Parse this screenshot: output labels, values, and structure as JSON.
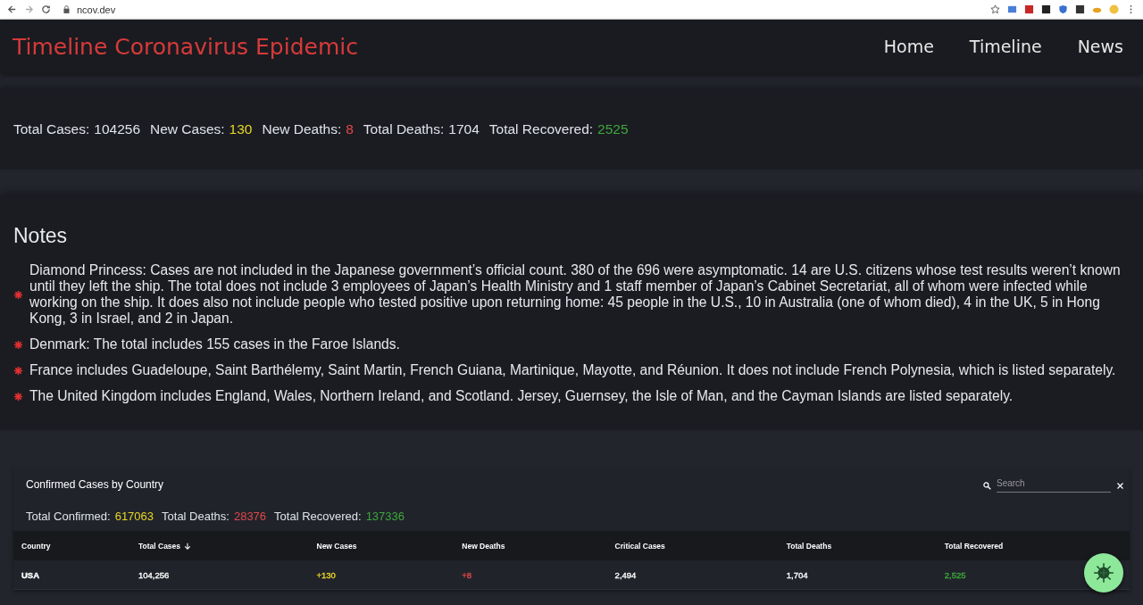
{
  "browser": {
    "url": "ncov.dev"
  },
  "header": {
    "title": "Timeline Coronavirus Epidemic",
    "nav": [
      {
        "label": "Home"
      },
      {
        "label": "Timeline"
      },
      {
        "label": "News"
      }
    ]
  },
  "summary": [
    {
      "label": "Total Cases:",
      "value": "104256",
      "color": "#dfe3ea"
    },
    {
      "label": "New Cases:",
      "value": "130",
      "color": "#e8d626"
    },
    {
      "label": "New Deaths:",
      "value": "8",
      "color": "#e04848"
    },
    {
      "label": "Total Deaths:",
      "value": "1704",
      "color": "#dfe3ea"
    },
    {
      "label": "Total Recovered:",
      "value": "2525",
      "color": "#3ca83c"
    }
  ],
  "notes": {
    "title": "Notes",
    "items": [
      "Diamond Princess: Cases are not included in the Japanese government’s official count. 380 of the 696 were asymptomatic. 14 are U.S. citizens whose test results weren’t known until they left the ship. The total does not include 3 employees of Japan’s Health Ministry and 1 staff member of Japan’s Cabinet Secretariat, all of whom were infected while working on the ship. It does also not include people who tested positive upon returning home: 45 people in the U.S., 10 in Australia (one of whom died), 4 in the UK, 5 in Hong Kong, 3 in Israel, and 2 in Japan.",
      "Denmark: The total includes 155 cases in the Faroe Islands.",
      "France includes Guadeloupe, Saint Barthélemy, Saint Martin, French Guiana, Martinique, Mayotte, and Réunion. It does not include French Polynesia, which is listed separately.",
      "The United Kingdom includes England, Wales, Northern Ireland, and Scotland. Jersey, Guernsey, the Isle of Man, and the Cayman Islands are listed separately."
    ]
  },
  "table": {
    "title": "Confirmed Cases by Country",
    "search": {
      "placeholder": "Search"
    },
    "totals": [
      {
        "label": "Total Confirmed:",
        "value": "617063",
        "color": "#e8d626"
      },
      {
        "label": "Total Deaths:",
        "value": "28376",
        "color": "#e04848"
      },
      {
        "label": "Total Recovered:",
        "value": "137336",
        "color": "#3ca83c"
      }
    ],
    "columns": [
      {
        "label": "Country",
        "sorted": false
      },
      {
        "label": "Total Cases",
        "sorted": true
      },
      {
        "label": "New Cases",
        "sorted": false
      },
      {
        "label": "New Deaths",
        "sorted": false
      },
      {
        "label": "Critical Cases",
        "sorted": false
      },
      {
        "label": "Total Deaths",
        "sorted": false
      },
      {
        "label": "Total Recovered",
        "sorted": false
      }
    ],
    "rows": [
      {
        "cells": [
          {
            "text": "USA",
            "color": "#ffffff"
          },
          {
            "text": "104,256",
            "color": "#ffffff"
          },
          {
            "text": "+130",
            "color": "#e8d626"
          },
          {
            "text": "+8",
            "color": "#e04848"
          },
          {
            "text": "2,494",
            "color": "#ffffff"
          },
          {
            "text": "1,704",
            "color": "#ffffff"
          },
          {
            "text": "2,525",
            "color": "#3ca83c"
          }
        ]
      }
    ]
  }
}
